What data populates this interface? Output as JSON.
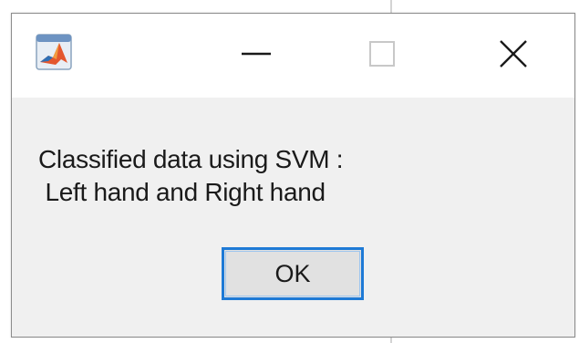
{
  "window": {
    "app_icon": "matlab-icon",
    "controls": {
      "minimize_icon": "minimize-icon",
      "maximize_icon": "maximize-icon",
      "close_icon": "close-icon"
    }
  },
  "message": {
    "line1": "Classified data using SVM :",
    "line2": " Left hand and Right hand"
  },
  "ok_button": {
    "label": "OK"
  },
  "colors": {
    "title_bar": "#ffffff",
    "dialog_body": "#f0f0f0",
    "button_focus_border": "#1e7ad6",
    "button_face": "#e1e1e1"
  }
}
